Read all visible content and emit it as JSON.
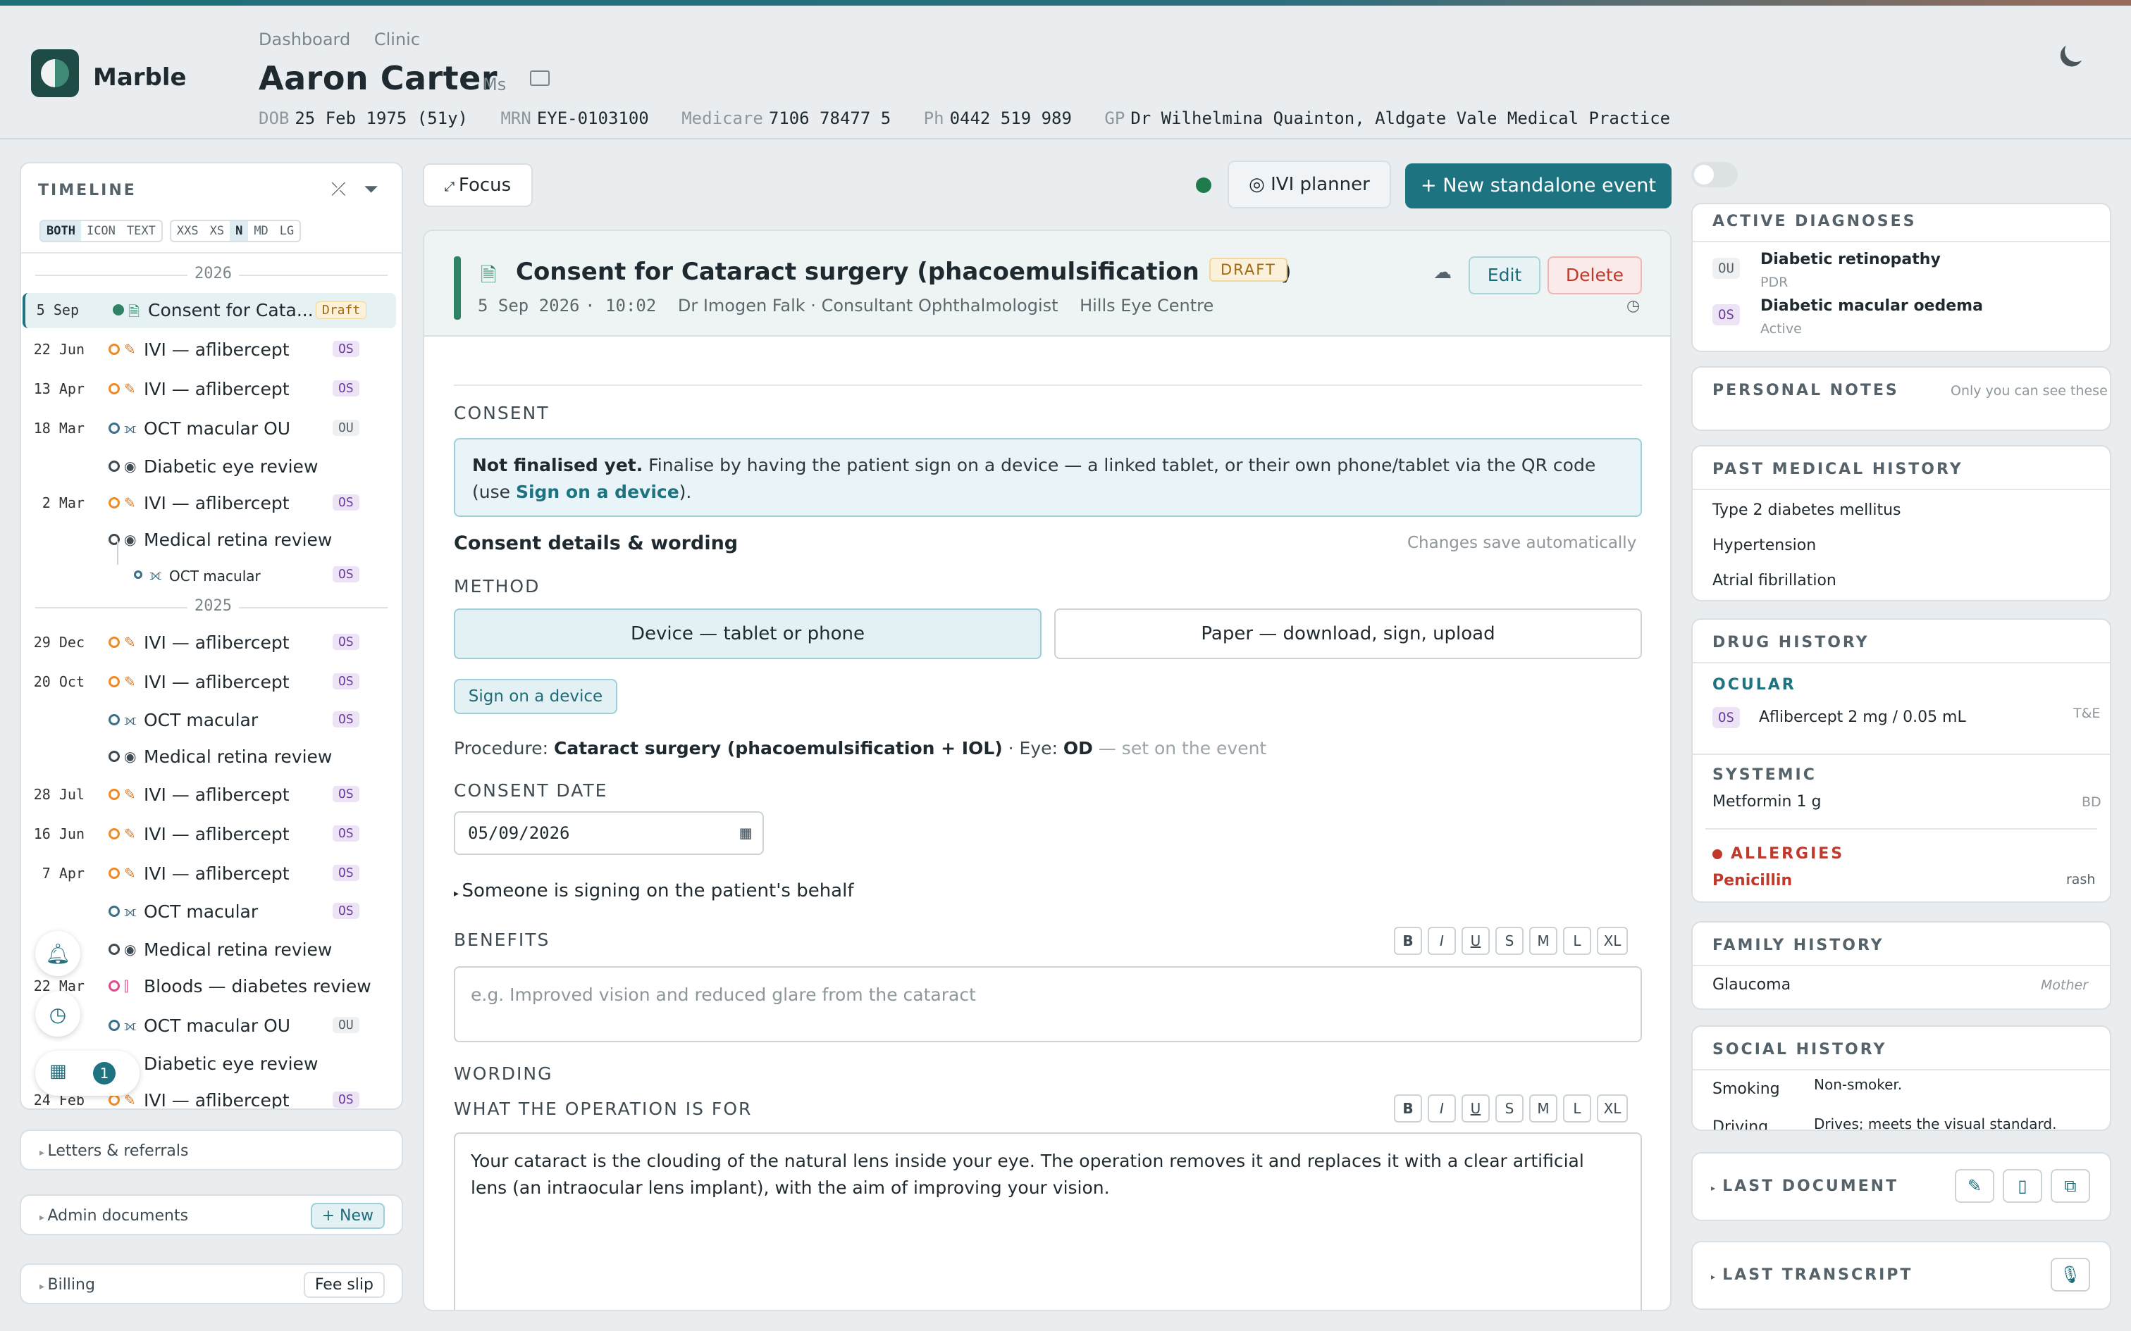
{
  "app": {
    "name": "Marble"
  },
  "breadcrumb": [
    "Dashboard",
    "Clinic"
  ],
  "patient": {
    "name": "Aaron Carter",
    "title": "Ms",
    "dob_label": "DOB",
    "dob": "25 Feb 1975 (51y)",
    "mrn_label": "MRN",
    "mrn": "EYE-0103100",
    "medicare_label": "Medicare",
    "medicare": "7106 78477 5",
    "ph_label": "Ph",
    "ph": "0442 519 989",
    "gp_label": "GP",
    "gp": "Dr Wilhelmina Quainton, Aldgate Vale Medical Practice"
  },
  "timeline": {
    "title": "TIMELINE",
    "modes": [
      "BOTH",
      "ICON",
      "TEXT"
    ],
    "sizes": [
      "XXS",
      "XS",
      "N",
      "MD",
      "LG"
    ],
    "years": [
      "2026",
      "2025"
    ],
    "rows": [
      {
        "date": "5 Sep",
        "label": "Consent for Cata...",
        "badge": "Draft"
      },
      {
        "date": "22 Jun",
        "label": "IVI — aflibercept",
        "badge": "OS"
      },
      {
        "date": "13 Apr",
        "label": "IVI — aflibercept",
        "badge": "OS"
      },
      {
        "date": "18 Mar",
        "label": "OCT macular OU",
        "badge": "OU"
      },
      {
        "date": "",
        "label": "Diabetic eye review",
        "badge": ""
      },
      {
        "date": "2 Mar",
        "label": "IVI — aflibercept",
        "badge": "OS"
      },
      {
        "date": "",
        "label": "Medical retina review",
        "badge": ""
      },
      {
        "date": "",
        "label": "OCT macular",
        "badge": "OS"
      },
      {
        "date": "29 Dec",
        "label": "IVI — aflibercept",
        "badge": "OS"
      },
      {
        "date": "20 Oct",
        "label": "IVI — aflibercept",
        "badge": "OS"
      },
      {
        "date": "",
        "label": "OCT macular",
        "badge": "OS"
      },
      {
        "date": "",
        "label": "Medical retina review",
        "badge": ""
      },
      {
        "date": "28 Jul",
        "label": "IVI — aflibercept",
        "badge": "OS"
      },
      {
        "date": "16 Jun",
        "label": "IVI — aflibercept",
        "badge": "OS"
      },
      {
        "date": "7 Apr",
        "label": "IVI — aflibercept",
        "badge": "OS"
      },
      {
        "date": "",
        "label": "OCT macular",
        "badge": "OS"
      },
      {
        "date": "",
        "label": "Medical retina review",
        "badge": ""
      },
      {
        "date": "22 Mar",
        "label": "Bloods — diabetes review",
        "badge": ""
      },
      {
        "date": "",
        "label": "OCT macular OU",
        "badge": "OU"
      },
      {
        "date": "",
        "label": "Diabetic eye review",
        "badge": ""
      },
      {
        "date": "24 Feb",
        "label": "IVI — aflibercept",
        "badge": "OS"
      }
    ],
    "calendar_count": "1"
  },
  "left_cards": {
    "letters": "Letters & referrals",
    "admin": "Admin documents",
    "admin_btn": "+ New",
    "billing": "Billing",
    "billing_btn": "Fee slip"
  },
  "toolbar": {
    "focus": "Focus",
    "ivi_planner": "◎ IVI planner",
    "new_event": "+ New standalone event"
  },
  "event": {
    "title": "Consent for Cataract surgery (phacoemulsification + IOL)",
    "status": "DRAFT",
    "date": "5 Sep 2026",
    "time": "10:02",
    "clinician": "Dr Imogen Falk · Consultant Ophthalmologist",
    "location": "Hills Eye Centre",
    "edit": "Edit",
    "delete": "Delete"
  },
  "consent": {
    "heading": "CONSENT",
    "notice_bold": "Not finalised yet.",
    "notice_text": " Finalise by having the patient sign on a device — a linked tablet, or their own phone/tablet via the QR code (use ",
    "notice_link": "Sign on a device",
    "notice_end": ").",
    "details": "Consent details & wording",
    "autosave": "Changes save automatically",
    "method_label": "METHOD",
    "method_device": "Device — tablet or phone",
    "method_paper": "Paper — download, sign, upload",
    "sign_btn": "Sign on a device",
    "procedure_label": "Procedure:",
    "procedure": "Cataract surgery (phacoemulsification + IOL)",
    "eye_label": "· Eye:",
    "eye": "OD",
    "eye_note": "— set on the event",
    "date_label": "CONSENT DATE",
    "date": "05/09/2026",
    "behalf": "Someone is signing on the patient's behalf",
    "benefits_label": "BENEFITS",
    "benefits_placeholder": "e.g. Improved vision and reduced glare from the cataract",
    "wording_label": "WORDING",
    "operation_label": "WHAT THE OPERATION IS FOR",
    "operation_text": "Your cataract is the clouding of the natural lens inside your eye. The operation removes it and replaces it with a clear artificial lens (an intraocular lens implant), with the aim of improving your vision.",
    "fmt": [
      "B",
      "I",
      "U",
      "S",
      "M",
      "L",
      "XL"
    ]
  },
  "right": {
    "diagnoses_title": "ACTIVE DIAGNOSES",
    "diagnoses": [
      {
        "eye": "OU",
        "name": "Diabetic retinopathy",
        "sub": "PDR"
      },
      {
        "eye": "OS",
        "name": "Diabetic macular oedema",
        "sub": "Active"
      }
    ],
    "notes_title": "PERSONAL NOTES",
    "notes_hint": "Only you can see these",
    "pmh_title": "PAST MEDICAL HISTORY",
    "pmh": [
      "Type 2 diabetes mellitus",
      "Hypertension",
      "Atrial fibrillation"
    ],
    "drug_title": "DRUG HISTORY",
    "ocular_label": "OCULAR",
    "ocular_eye": "OS",
    "ocular_drug": "Aflibercept 2 mg / 0.05 mL",
    "ocular_freq": "T&E",
    "systemic_label": "SYSTEMIC",
    "systemic_drug": "Metformin 1 g",
    "systemic_freq": "BD",
    "allergies_label": "ALLERGIES",
    "allergy": "Penicillin",
    "allergy_reaction": "rash",
    "family_title": "FAMILY HISTORY",
    "family_item": "Glaucoma",
    "family_rel": "Mother",
    "social_title": "SOCIAL HISTORY",
    "social": [
      {
        "k": "Smoking",
        "v": "Non-smoker."
      },
      {
        "k": "Driving",
        "v": "Drives; meets the visual standard."
      }
    ],
    "last_doc": "LAST DOCUMENT",
    "last_transcript": "LAST TRANSCRIPT"
  },
  "colors": {
    "accent": "#1e7381",
    "draft": "#a26a10",
    "allergy": "#c0392b",
    "ivi": "#f08a24"
  }
}
